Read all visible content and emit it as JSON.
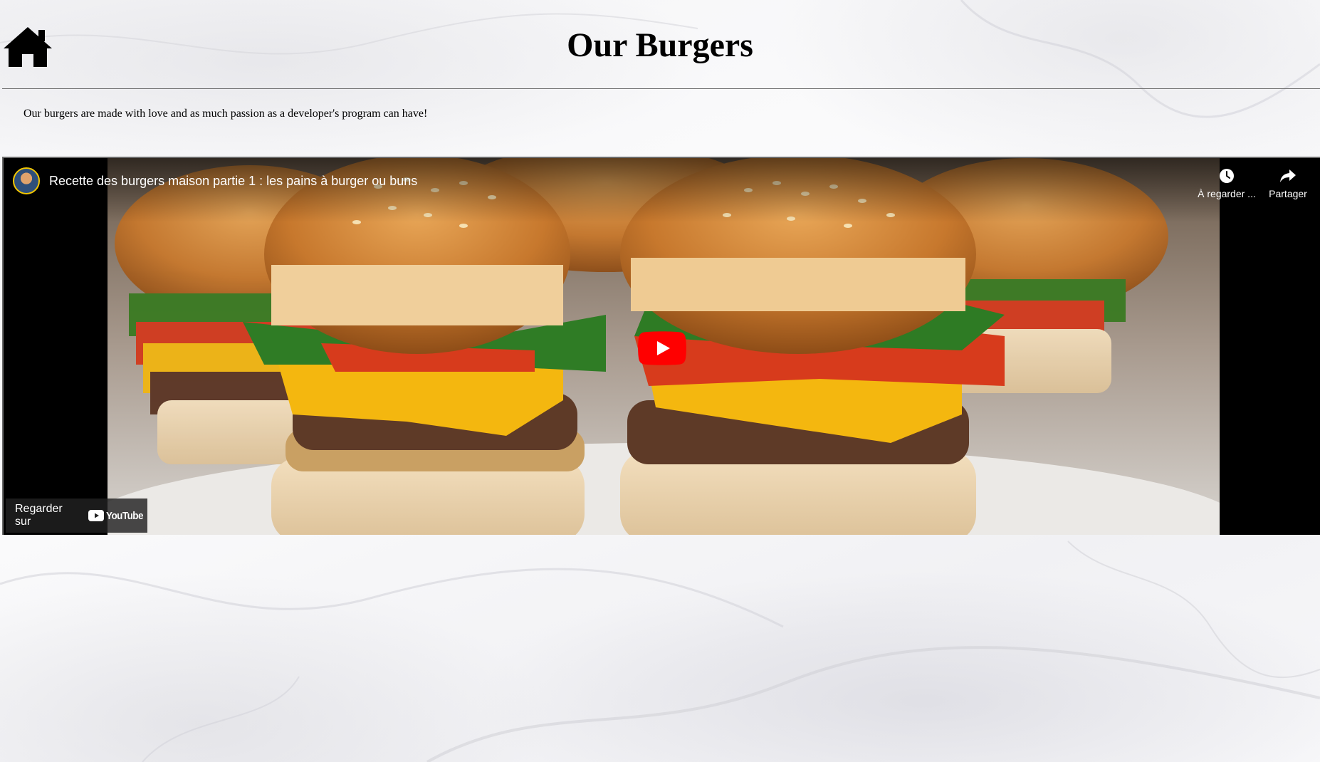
{
  "page": {
    "title": "Our Burgers",
    "intro": "Our burgers are made with love and as much passion as a developer's program can have!"
  },
  "nav": {
    "home_icon": "home-icon"
  },
  "video": {
    "title": "Recette des burgers maison partie 1 : les pains à burger ou buns",
    "watch_later_label": "À regarder ...",
    "share_label": "Partager",
    "watch_on_label": "Regarder sur",
    "youtube_logo_text": "YouTube",
    "play_icon": "play-icon",
    "colors": {
      "play_red": "#ff0000",
      "overlay": "#212121"
    }
  }
}
